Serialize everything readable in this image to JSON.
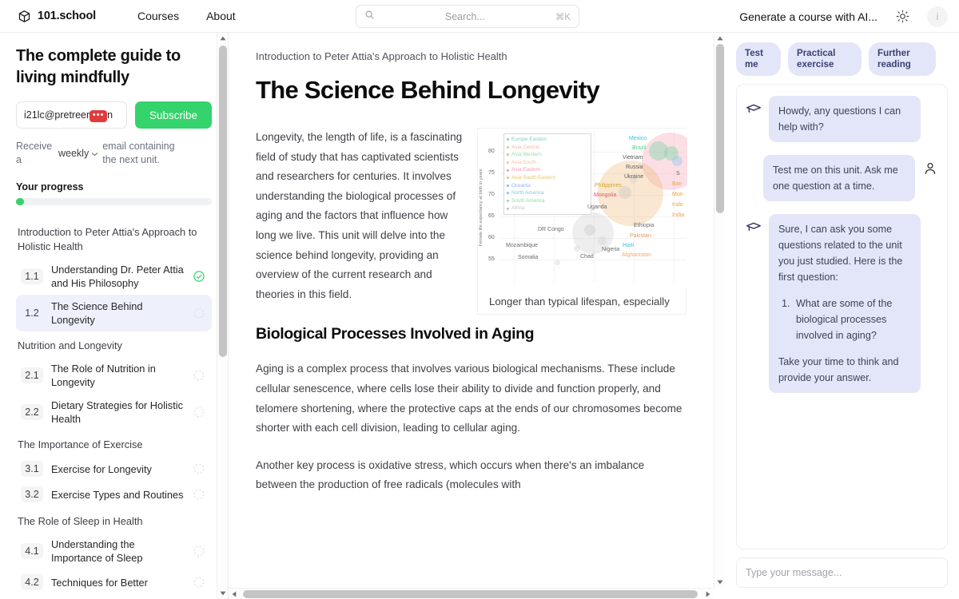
{
  "header": {
    "brand": "101.school",
    "brand_icon": "cube-icon",
    "nav": [
      {
        "label": "Courses"
      },
      {
        "label": "About"
      }
    ],
    "search": {
      "placeholder": "Search...",
      "shortcut": "⌘K",
      "icon": "search-icon"
    },
    "generate_ai_label": "Generate a course with AI...",
    "theme_icon": "sun-icon",
    "avatar_label": "i"
  },
  "sidebar": {
    "course_title": "The complete guide to living mindfully",
    "email_value_prefix": "i21lc@pretreer",
    "email_redacted": "•••",
    "email_value_suffix": "n",
    "subscribe_label": "Subscribe",
    "receive_prefix": "Receive a",
    "frequency": "weekly",
    "receive_suffix": "email containing the next unit.",
    "progress_label": "Your progress",
    "progress_percent": 4,
    "toc": [
      {
        "chapter": "Introduction to Peter Attia's Approach to Holistic Health",
        "units": [
          {
            "num": "1.1",
            "label": "Understanding Dr. Peter Attia and His Philosophy",
            "state": "done",
            "active": false
          },
          {
            "num": "1.2",
            "label": "The Science Behind Longevity",
            "state": "pending",
            "active": true
          }
        ]
      },
      {
        "chapter": "Nutrition and Longevity",
        "units": [
          {
            "num": "2.1",
            "label": "The Role of Nutrition in Longevity",
            "state": "pending",
            "active": false
          },
          {
            "num": "2.2",
            "label": "Dietary Strategies for Holistic Health",
            "state": "pending",
            "active": false
          }
        ]
      },
      {
        "chapter": "The Importance of Exercise",
        "units": [
          {
            "num": "3.1",
            "label": "Exercise for Longevity",
            "state": "pending",
            "active": false
          },
          {
            "num": "3.2",
            "label": "Exercise Types and Routines",
            "state": "pending",
            "active": false
          }
        ]
      },
      {
        "chapter": "The Role of Sleep in Health",
        "units": [
          {
            "num": "4.1",
            "label": "Understanding the Importance of Sleep",
            "state": "pending",
            "active": false
          },
          {
            "num": "4.2",
            "label": "Techniques for Better",
            "state": "pending",
            "active": false
          }
        ]
      }
    ]
  },
  "main": {
    "breadcrumb": "Introduction to Peter Attia's Approach to Holistic Health",
    "unit_title": "The Science Behind Longevity",
    "paragraph_1": "Longevity, the length of life, is a fascinating field of study that has captivated scientists and researchers for centuries. It involves understanding the biological processes of aging and the factors that influence how long we live. This unit will delve into the science behind longevity, providing an overview of the current research and theories in this field.",
    "section_heading": "Biological Processes Involved in Aging",
    "paragraph_2": "Aging is a complex process that involves various biological mechanisms. These include cellular senescence, where cells lose their ability to divide and function properly, and telomere shortening, where the protective caps at the ends of our chromosomes become shorter with each cell division, leading to cellular aging.",
    "paragraph_3": "Another key process is oxidative stress, which occurs when there's an imbalance between the production of free radicals (molecules with"
  },
  "chart_data": {
    "type": "scatter",
    "title": "",
    "caption": "Longer than typical lifespan, especially",
    "xlabel": "",
    "ylabel": "Female life expectancy at birth in years",
    "yticks": [
      55,
      60,
      65,
      70,
      75,
      80
    ],
    "ylim": [
      52,
      84
    ],
    "grid": true,
    "legend_position": "top-left",
    "legend": [
      {
        "name": "Europe Eastern",
        "color": "#7fd1c4"
      },
      {
        "name": "Asia Central",
        "color": "#f2b8a8"
      },
      {
        "name": "Asia Western",
        "color": "#9fd8a6"
      },
      {
        "name": "Asia South",
        "color": "#f0c5a0"
      },
      {
        "name": "Asia Eastern",
        "color": "#ef9aa8"
      },
      {
        "name": "Asia South-Eastern",
        "color": "#e8c070"
      },
      {
        "name": "Oceania",
        "color": "#8fb6ef"
      },
      {
        "name": "North America",
        "color": "#7fc9e8"
      },
      {
        "name": "South America",
        "color": "#8fdca0"
      },
      {
        "name": "Africa",
        "color": "#c2c2c2"
      }
    ],
    "points": [
      {
        "label": "Mexico",
        "x": 0.71,
        "y": 82.0,
        "color": "#3cbfe0"
      },
      {
        "label": "Brazil",
        "x": 0.74,
        "y": 80.3,
        "color": "#58c97e"
      },
      {
        "label": "Vietnam",
        "x": 0.665,
        "y": 79.0,
        "color": "#5c5c5c"
      },
      {
        "label": "Russia",
        "x": 0.66,
        "y": 77.6,
        "color": "#5c5c5c"
      },
      {
        "label": "Ukraine",
        "x": 0.675,
        "y": 76.3,
        "color": "#5c5c5c"
      },
      {
        "label": "Philippines",
        "x": 0.615,
        "y": 74.6,
        "color": "#d9a62a"
      },
      {
        "label": "Mongolia",
        "x": 0.6,
        "y": 73.3,
        "color": "#e8576e"
      },
      {
        "label": "Uganda",
        "x": 0.575,
        "y": 71.0,
        "color": "#6b6b6b"
      },
      {
        "label": "DR Congo",
        "x": 0.44,
        "y": 65.2,
        "color": "#6b6b6b"
      },
      {
        "label": "Mozambique",
        "x": 0.355,
        "y": 61.8,
        "color": "#6b6b6b"
      },
      {
        "label": "Somalia",
        "x": 0.375,
        "y": 59.6,
        "color": "#6b6b6b"
      },
      {
        "label": "Chad",
        "x": 0.555,
        "y": 59.3,
        "color": "#6b6b6b"
      },
      {
        "label": "Nigeria",
        "x": 0.6,
        "y": 60.4,
        "color": "#6b6b6b"
      },
      {
        "label": "Ethiopia",
        "x": 0.79,
        "y": 67.5,
        "color": "#6b6b6b"
      },
      {
        "label": "Pakistan",
        "x": 0.785,
        "y": 66.2,
        "color": "#e09a6a"
      },
      {
        "label": "Haiti",
        "x": 0.755,
        "y": 65.0,
        "color": "#3cbfe0"
      },
      {
        "label": "Afghanistan",
        "x": 0.79,
        "y": 63.7,
        "color": "#f0a870"
      },
      {
        "label": "India",
        "x": 0.955,
        "y": 70.0,
        "color": "#e8a54a"
      },
      {
        "label": "Indo",
        "x": 0.955,
        "y": 71.6,
        "color": "#e8a54a"
      },
      {
        "label": "Mon",
        "x": 0.955,
        "y": 73.0,
        "color": "#e8a54a"
      },
      {
        "label": "Ban",
        "x": 0.955,
        "y": 74.4,
        "color": "#e8a54a"
      },
      {
        "label": "S",
        "x": 0.955,
        "y": 75.8,
        "color": "#6b6b6b"
      }
    ]
  },
  "chat": {
    "chips": [
      {
        "label": "Test me"
      },
      {
        "label": "Practical exercise"
      },
      {
        "label": "Further reading"
      }
    ],
    "messages": [
      {
        "role": "assistant",
        "icon": "graduation-cap-icon",
        "text": "Howdy, any questions I can help with?"
      },
      {
        "role": "user",
        "icon": "person-icon",
        "text": "Test me on this unit. Ask me one question at a time."
      },
      {
        "role": "assistant",
        "icon": "graduation-cap-icon",
        "intro": "Sure, I can ask you some questions related to the unit you just studied. Here is the first question:",
        "list": [
          "What are some of the biological processes involved in aging?"
        ],
        "outro": "Take your time to think and provide your answer."
      }
    ],
    "input_placeholder": "Type your message..."
  }
}
